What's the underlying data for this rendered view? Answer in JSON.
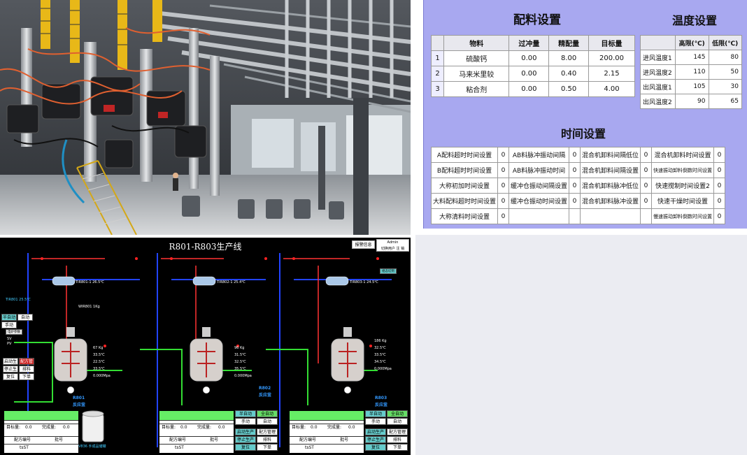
{
  "config_panel": {
    "recipe_title": "配料设置",
    "temp_title": "温度设置",
    "time_title": "时间设置",
    "recipe_headers": [
      "物料",
      "过冲量",
      "精配量",
      "目标量"
    ],
    "recipe_rows": [
      {
        "no": "1",
        "name": "硫酸钙",
        "overshoot": "0.00",
        "fine": "8.00",
        "target": "200.00"
      },
      {
        "no": "2",
        "name": "马来米里较",
        "overshoot": "0.00",
        "fine": "0.40",
        "target": "2.15"
      },
      {
        "no": "3",
        "name": "粘合剂",
        "overshoot": "0.00",
        "fine": "0.50",
        "target": "4.00"
      }
    ],
    "temp_headers": [
      "高限(℃)",
      "低限(℃)"
    ],
    "temp_rows": [
      {
        "label": "进风温度1",
        "high": "145",
        "low": "80"
      },
      {
        "label": "进风温度2",
        "high": "110",
        "low": "50"
      },
      {
        "label": "出风温度1",
        "high": "105",
        "low": "30"
      },
      {
        "label": "出风温度2",
        "high": "90",
        "low": "65"
      }
    ],
    "time_rows": [
      {
        "a": "A配料超时时间设置",
        "av": "0",
        "b": "AB料脉冲振动间隔",
        "bv": "0",
        "c": "混合机卸料间隔低位",
        "cv": "0",
        "d": "混合机卸料时间设置",
        "dv": "0"
      },
      {
        "a": "B配料超时时间设置",
        "av": "0",
        "b": "AB料脉冲振动时间",
        "bv": "0",
        "c": "混合机卸料间隔设置",
        "cv": "0",
        "d": "快速振动卸料倒数时间设置",
        "dv": "0"
      },
      {
        "a": "大称初加时间设置",
        "av": "0",
        "b": "缓冲仓振动间隔设置",
        "bv": "0",
        "c": "混合机卸料脉冲低位",
        "cv": "0",
        "d": "快速搅制时间设置2",
        "dv": "0"
      },
      {
        "a": "大料配料超时时间设置",
        "av": "0",
        "b": "缓冲仓振动时间设置",
        "bv": "0",
        "c": "混合机卸料脉冲设置",
        "cv": "0",
        "d": "快速干燥时间设置",
        "dv": "0"
      },
      {
        "a": "大称清料时间设置",
        "av": "0",
        "b": "",
        "bv": "",
        "c": "",
        "cv": "",
        "d": "慢速振动卸料倒数时间设置",
        "dv": "0"
      }
    ]
  },
  "scada": {
    "title": "R801-R803生产线",
    "alarm_btn": "报警信息",
    "login_user": "Admin",
    "login_actions": "切换用户 注 销",
    "right_tag": "组态切到",
    "temps": {
      "r1_top": "TIR801-1 26.5℃",
      "r2_top": "TIR802-1 25.4℃",
      "r3_top": "TIR803-1 24.5℃",
      "tir_left": "TIR801 25.5℃",
      "wir_left": "WIR801 1Kg"
    },
    "reactors": [
      {
        "id": "R801",
        "tag": "反应釜",
        "vals": [
          "67 Kg",
          "33.5℃",
          "22.5℃",
          "33.5℃",
          "0.000Mpa"
        ]
      },
      {
        "id": "R802",
        "tag": "反应釜",
        "vals": [
          "96 Kg",
          "31.5℃",
          "32.5℃",
          "35.5℃",
          "0.000Mpa"
        ]
      },
      {
        "id": "R803",
        "tag": "反应釜",
        "vals": [
          "186 Kg",
          "32.5℃",
          "33.5℃",
          "34.5℃",
          "0.000Mpa"
        ]
      }
    ],
    "controls": {
      "semi_auto": "半自动",
      "full_auto": "全自动",
      "manual": "手动",
      "auto": "自动",
      "start": "启动生产",
      "recipe_mgmt": "配方管理",
      "stop": "停止生产",
      "feed": "排料",
      "reset": "复位",
      "discharge": "下单"
    },
    "panel": {
      "target_lbl": "目标量:",
      "target_val": "0.0",
      "done_lbl": "完成量:",
      "done_val": "0.0",
      "recipe_no": "配方编号",
      "batch": "批号",
      "recipe_val": "tsST"
    },
    "storage_tank": "V836 手成品储罐",
    "heating": "电炉参数",
    "sv_pv": [
      "SV",
      "PV"
    ]
  }
}
